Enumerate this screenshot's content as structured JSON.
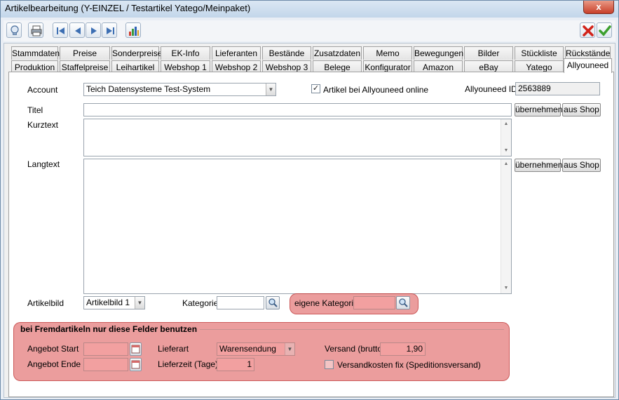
{
  "window": {
    "title": "Artikelbearbeitung (Y-EINZEL / Testartikel Yatego/Meinpaket)",
    "close": "x"
  },
  "toolbar": {
    "buttons": [
      "lightbulb-icon",
      "print-icon",
      "first-icon",
      "prev-icon",
      "next-icon",
      "last-icon",
      "chart-icon"
    ],
    "cancel": "cancel-icon",
    "ok": "ok-icon"
  },
  "tabs_row1": [
    "Stammdaten",
    "Preise",
    "Sonderpreise",
    "EK-Info",
    "Lieferanten",
    "Bestände",
    "Zusatzdaten",
    "Memo",
    "Bewegungen",
    "Bilder",
    "Stückliste",
    "Rückstände"
  ],
  "tabs_row2": [
    "Produktion",
    "Staffelpreise",
    "Leihartikel",
    "Webshop 1",
    "Webshop 2",
    "Webshop 3",
    "Belege",
    "Konfigurator",
    "Amazon",
    "eBay",
    "Yatego",
    "Allyouneed"
  ],
  "active_tab": "Allyouneed",
  "form": {
    "account_label": "Account",
    "account_value": "Teich Datensysteme Test-System",
    "online_label": "Artikel bei Allyouneed online",
    "online_checked": true,
    "id_label": "Allyouneed ID",
    "id_value": "2563889",
    "titel_label": "Titel",
    "titel_value": "",
    "uebernehmen_label": "übernehmen",
    "aus_shop_label": "aus Shop",
    "kurztext_label": "Kurztext",
    "langtext_label": "Langtext",
    "artikelbild_label": "Artikelbild",
    "artikelbild_value": "Artikelbild 1",
    "kategorie_label": "Kategorie",
    "kategorie_value": "",
    "eigene_kategorie_label": "eigene Kategorie",
    "eigene_kategorie_value": ""
  },
  "fremd": {
    "group_title": "bei Fremdartikeln nur diese Felder benutzen",
    "angebot_start_label": "Angebot Start",
    "angebot_start_value": "",
    "angebot_ende_label": "Angebot Ende",
    "angebot_ende_value": "",
    "lieferart_label": "Lieferart",
    "lieferart_value": "Warensendung",
    "lieferzeit_label": "Lieferzeit (Tage)",
    "lieferzeit_value": "1",
    "versand_label": "Versand (brutto)",
    "versand_value": "1,90",
    "versandkosten_fix_label": "Versandkosten fix  (Speditionsversand)",
    "versandkosten_fix_checked": false
  },
  "colors": {
    "highlight": "#da4c4c",
    "field_pink": "#f2a0a0"
  }
}
